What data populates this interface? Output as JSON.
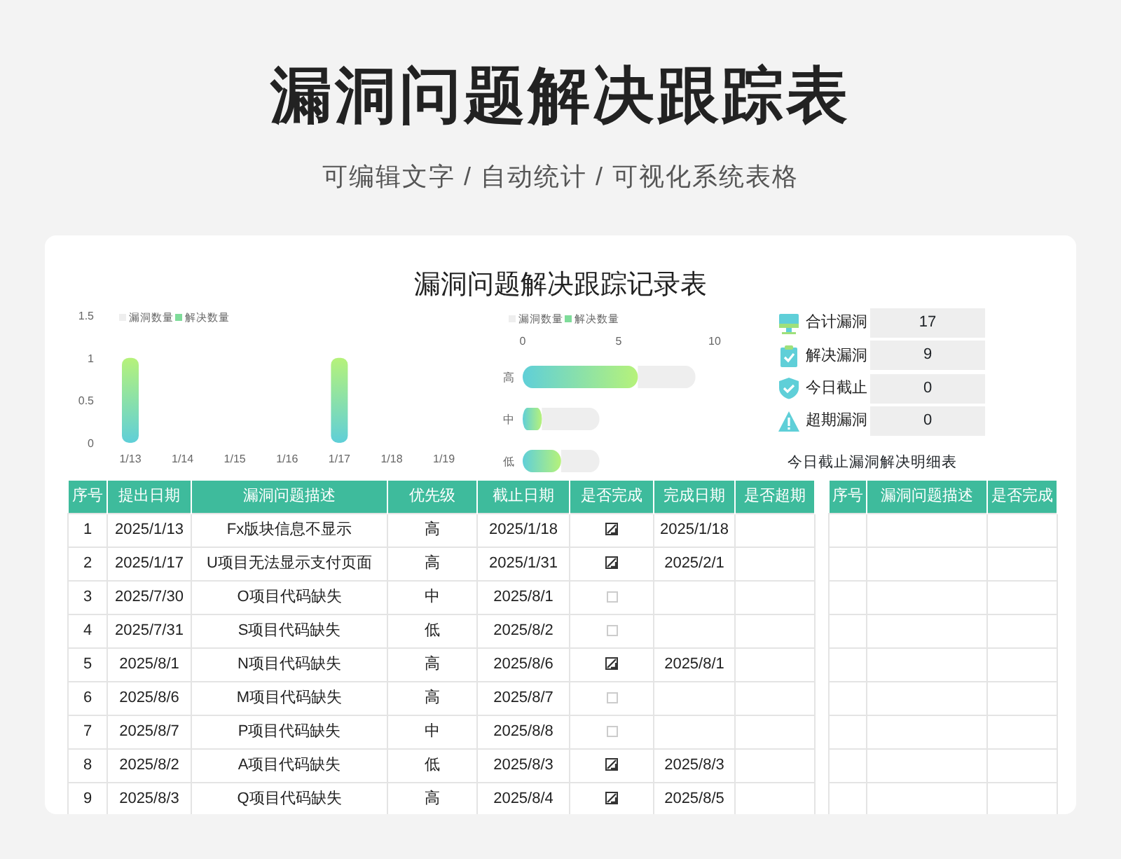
{
  "title": "漏洞问题解决跟踪表",
  "subtitle": "可编辑文字 / 自动统计 / 可视化系统表格",
  "sheet": {
    "title": "漏洞问题解决跟踪记录表",
    "column_chart": {
      "chart_data": {
        "type": "bar",
        "orientation": "vertical",
        "legend": "top",
        "categories": [
          "1/13",
          "1/14",
          "1/15",
          "1/16",
          "1/17",
          "1/18",
          "1/19"
        ],
        "yticks": [
          {
            "value": 0,
            "label": "0"
          },
          {
            "value": 0.5,
            "label": "0.5"
          },
          {
            "value": 1,
            "label": "1"
          },
          {
            "value": 1.5,
            "label": "1.5"
          }
        ],
        "ylim": [
          0,
          1.5
        ],
        "series": [
          {
            "name": "解决数量",
            "color": "#7fdc9a",
            "values": [
              1,
              0,
              0,
              0,
              1,
              0,
              0
            ]
          },
          {
            "name": "漏洞数量",
            "color": "#eeeeee",
            "values": [
              0,
              0,
              0,
              0,
              0,
              0,
              0
            ]
          }
        ]
      }
    },
    "bar_chart": {
      "chart_data": {
        "type": "bar",
        "orientation": "horizontal",
        "stacked": true,
        "legend": "top",
        "categories": [
          "高",
          "中",
          "低"
        ],
        "xticks": [
          {
            "value": 0,
            "label": "0"
          },
          {
            "value": 5,
            "label": "5"
          },
          {
            "value": 10,
            "label": "10"
          }
        ],
        "xlim": [
          0,
          10
        ],
        "series": [
          {
            "name": "解决数量",
            "color": "#7fdc9a",
            "values": [
              6,
              1,
              2
            ]
          },
          {
            "name": "漏洞数量",
            "color": "#eeeeee",
            "values": [
              3,
              3,
              2
            ]
          }
        ]
      }
    },
    "stats": [
      {
        "kind": "monitor",
        "label": "合计漏洞",
        "value": "17"
      },
      {
        "kind": "clipboard",
        "label": "解决漏洞",
        "value": "9"
      },
      {
        "kind": "shield",
        "label": "今日截止",
        "value": "0"
      },
      {
        "kind": "warning",
        "label": "超期漏洞",
        "value": "0"
      }
    ],
    "main_table": {
      "columns": [
        "序号",
        "提出日期",
        "漏洞问题描述",
        "优先级",
        "截止日期",
        "是否完成",
        "完成日期",
        "是否超期"
      ],
      "rows": [
        {
          "no": "1",
          "date": "2025/1/13",
          "desc": "Fx版块信息不显示",
          "priority": "高",
          "due": "2025/1/18",
          "done": true,
          "done_date": "2025/1/18"
        },
        {
          "no": "2",
          "date": "2025/1/17",
          "desc": "U项目无法显示支付页面",
          "priority": "高",
          "due": "2025/1/31",
          "done": true,
          "done_date": "2025/2/1"
        },
        {
          "no": "3",
          "date": "2025/7/30",
          "desc": "O项目代码缺失",
          "priority": "中",
          "due": "2025/8/1",
          "done": false
        },
        {
          "no": "4",
          "date": "2025/7/31",
          "desc": "S项目代码缺失",
          "priority": "低",
          "due": "2025/8/2",
          "done": false
        },
        {
          "no": "5",
          "date": "2025/8/1",
          "desc": "N项目代码缺失",
          "priority": "高",
          "due": "2025/8/6",
          "done": true,
          "done_date": "2025/8/1"
        },
        {
          "no": "6",
          "date": "2025/8/6",
          "desc": "M项目代码缺失",
          "priority": "高",
          "due": "2025/8/7",
          "done": false
        },
        {
          "no": "7",
          "date": "2025/8/7",
          "desc": "P项目代码缺失",
          "priority": "中",
          "due": "2025/8/8",
          "done": false
        },
        {
          "no": "8",
          "date": "2025/8/2",
          "desc": "A项目代码缺失",
          "priority": "低",
          "due": "2025/8/3",
          "done": true,
          "done_date": "2025/8/3"
        },
        {
          "no": "9",
          "date": "2025/8/3",
          "desc": "Q项目代码缺失",
          "priority": "高",
          "due": "2025/8/4",
          "done": true,
          "done_date": "2025/8/5"
        }
      ]
    },
    "detail_table": {
      "title": "今日截止漏洞解决明细表",
      "columns": [
        "序号",
        "漏洞问题描述",
        "是否完成"
      ]
    }
  }
}
